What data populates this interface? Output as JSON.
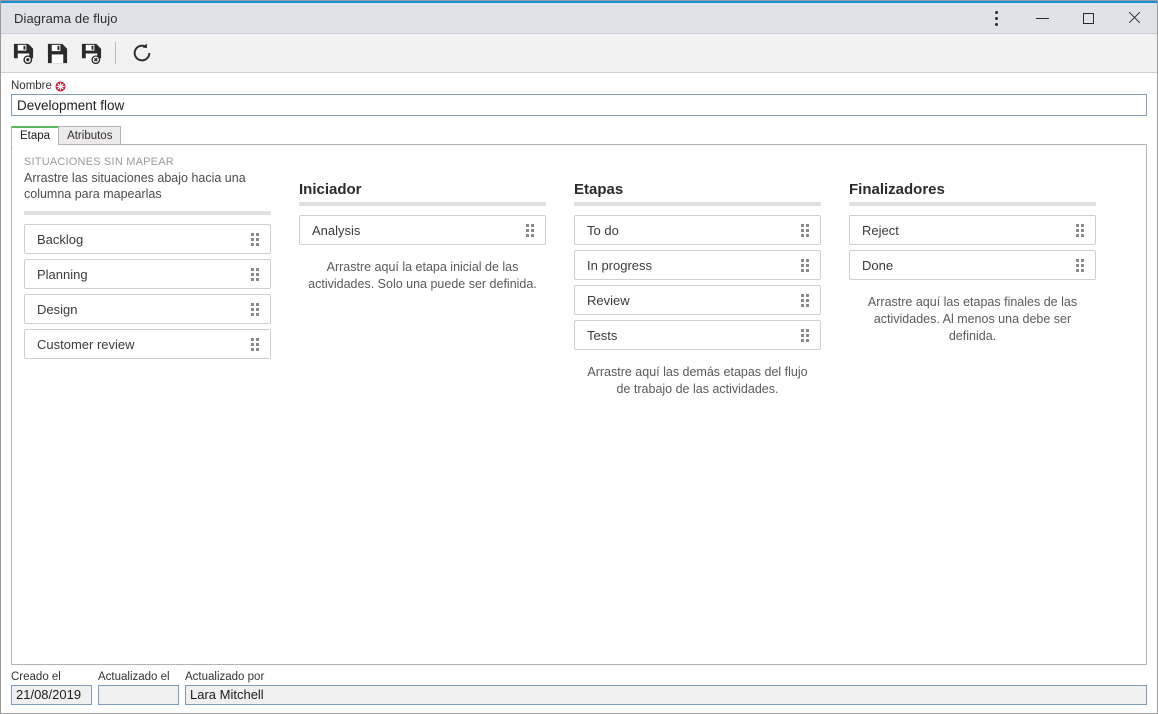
{
  "window": {
    "title": "Diagrama de flujo",
    "controls": {
      "menu": "⋮",
      "minimize": "—",
      "maximize": "□",
      "close": "✕"
    }
  },
  "toolbar": {
    "save_new_tooltip": "Guardar y nuevo",
    "save_tooltip": "Guardar",
    "save_delete_tooltip": "Guardar y eliminar",
    "refresh_tooltip": "Actualizar"
  },
  "name_field": {
    "label": "Nombre",
    "required": true,
    "value": "Development flow",
    "placeholder": ""
  },
  "tabs": [
    {
      "label": "Etapa",
      "active": true
    },
    {
      "label": "Atributos",
      "active": false
    }
  ],
  "columns": {
    "unmapped": {
      "title": "SITUACIONES SIN MAPEAR",
      "description": "Arrastre las situaciones abajo hacia una columna para mapearlas",
      "cards": [
        {
          "label": "Backlog"
        },
        {
          "label": "Planning"
        },
        {
          "label": "Design"
        },
        {
          "label": "Customer review"
        }
      ]
    },
    "initiator": {
      "title": "Iniciador",
      "cards": [
        {
          "label": "Analysis"
        }
      ],
      "hint": "Arrastre aquí la etapa inicial de las actividades. Solo una puede ser definida."
    },
    "stages": {
      "title": "Etapas",
      "cards": [
        {
          "label": "To do"
        },
        {
          "label": "In progress"
        },
        {
          "label": "Review"
        },
        {
          "label": "Tests"
        }
      ],
      "hint": "Arrastre aquí las demás etapas del flujo de trabajo de las actividades."
    },
    "finalizers": {
      "title": "Finalizadores",
      "cards": [
        {
          "label": "Reject"
        },
        {
          "label": "Done"
        }
      ],
      "hint": "Arrastre aquí las etapas finales de las actividades. Al menos una debe ser definida."
    }
  },
  "footer": {
    "created_label": "Creado el",
    "created_value": "21/08/2019",
    "updated_label": "Actualizado el",
    "updated_value": "",
    "updated_by_label": "Actualizado por",
    "updated_by_value": "Lara Mitchell"
  },
  "colors": {
    "accent": "#1a8fd8",
    "tab_active": "#5cb85c",
    "required": "#d0021b",
    "titlebar": "#dfe3e8"
  }
}
